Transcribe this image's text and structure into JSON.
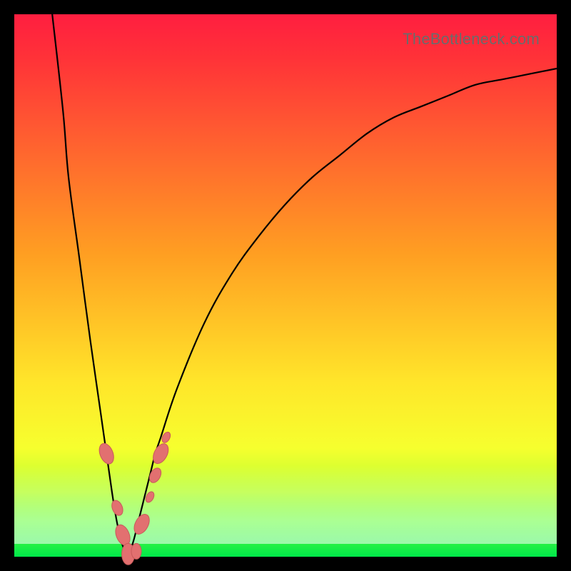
{
  "watermark": "TheBottleneck.com",
  "colors": {
    "frame": "#000000",
    "gradient_top": "#ff1e40",
    "gradient_bottom": "#00e84a",
    "curve": "#000000",
    "bead_fill": "#e27070",
    "bead_stroke": "#c85a5a",
    "watermark_text": "#6b6b6b"
  },
  "chart_data": {
    "type": "line",
    "title": "",
    "xlabel": "",
    "ylabel": "",
    "xlim": [
      0,
      100
    ],
    "ylim": [
      0,
      100
    ],
    "grid": false,
    "legend": false,
    "series": [
      {
        "name": "left-branch",
        "x": [
          7,
          9,
          10,
          12,
          14,
          16,
          18,
          19,
          20,
          21
        ],
        "y": [
          100,
          82,
          70,
          55,
          40,
          26,
          12,
          6,
          2,
          0
        ]
      },
      {
        "name": "right-branch",
        "x": [
          21,
          22,
          23,
          24,
          25,
          26,
          27,
          30,
          35,
          40,
          45,
          50,
          55,
          60,
          65,
          70,
          75,
          80,
          85,
          90,
          95,
          100
        ],
        "y": [
          0,
          3,
          7,
          11,
          15,
          19,
          22,
          31,
          43,
          52,
          59,
          65,
          70,
          74,
          78,
          81,
          83,
          85,
          87,
          88,
          89,
          90
        ]
      }
    ],
    "annotations": {
      "beads": [
        {
          "branch": "left",
          "x": 17.0,
          "y": 19.0,
          "size": "large"
        },
        {
          "branch": "left",
          "x": 19.0,
          "y": 9.0,
          "size": "med"
        },
        {
          "branch": "left",
          "x": 20.0,
          "y": 4.0,
          "size": "large"
        },
        {
          "branch": "bottom",
          "x": 21.0,
          "y": 0.5,
          "size": "large"
        },
        {
          "branch": "bottom",
          "x": 22.5,
          "y": 1.0,
          "size": "med"
        },
        {
          "branch": "right",
          "x": 23.5,
          "y": 6.0,
          "size": "large"
        },
        {
          "branch": "right",
          "x": 25.0,
          "y": 11.0,
          "size": "small"
        },
        {
          "branch": "right",
          "x": 26.0,
          "y": 15.0,
          "size": "med"
        },
        {
          "branch": "right",
          "x": 27.0,
          "y": 19.0,
          "size": "large"
        },
        {
          "branch": "right",
          "x": 28.0,
          "y": 22.0,
          "size": "small"
        }
      ]
    }
  }
}
